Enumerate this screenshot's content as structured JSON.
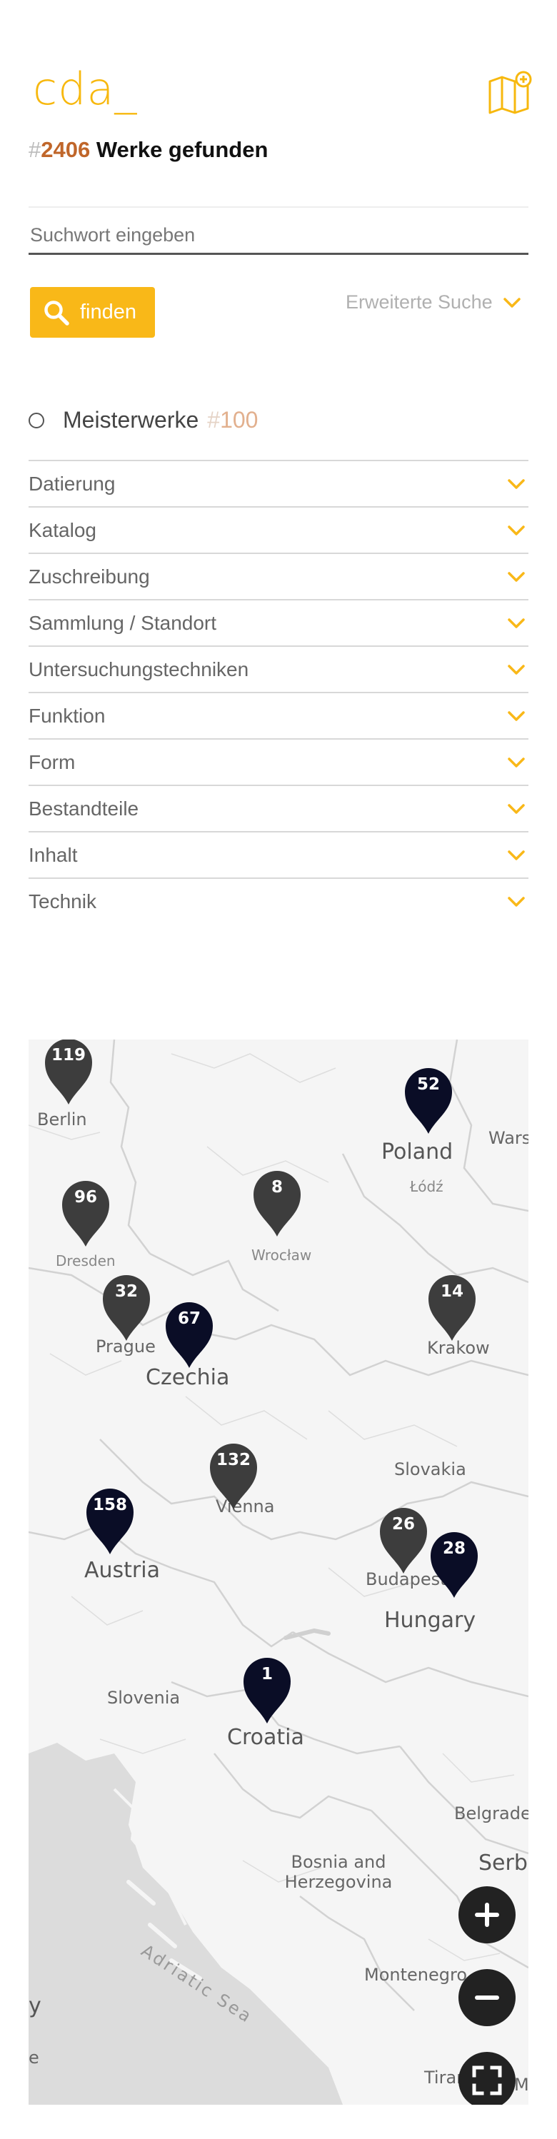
{
  "header": {
    "logo": "cda_",
    "map_icon": "map-plus-icon"
  },
  "results": {
    "hash": "#",
    "count": "2406",
    "label": " Werke gefunden"
  },
  "search": {
    "placeholder": "Suchwort eingeben",
    "button_label": "finden",
    "advanced_label": "Erweiterte Suche"
  },
  "masterworks": {
    "label": "Meisterwerke",
    "hash": "#",
    "count": "100"
  },
  "filters": [
    "Datierung",
    "Katalog",
    "Zuschreibung",
    "Sammlung / Standort",
    "Untersuchungstechniken",
    "Funktion",
    "Form",
    "Bestandteile",
    "Inhalt",
    "Technik"
  ],
  "map": {
    "pins": [
      {
        "label": "119",
        "dark": false
      },
      {
        "label": "52",
        "dark": true
      },
      {
        "label": "96",
        "dark": false
      },
      {
        "label": "8",
        "dark": false
      },
      {
        "label": "32",
        "dark": false
      },
      {
        "label": "67",
        "dark": true
      },
      {
        "label": "14",
        "dark": false
      },
      {
        "label": "132",
        "dark": false
      },
      {
        "label": "158",
        "dark": true
      },
      {
        "label": "26",
        "dark": false
      },
      {
        "label": "28",
        "dark": true
      },
      {
        "label": "1",
        "dark": true
      }
    ],
    "places": [
      "Berlin",
      "Poland",
      "Wars",
      "Łódź",
      "Dresden",
      "Wrocław",
      "Prague",
      "Czechia",
      "Krakow",
      "Slovakia",
      "Vienna",
      "Austria",
      "Budapest",
      "Hungary",
      "Slovenia",
      "Croatia",
      "Belgrade",
      "Bosnia and",
      "Herzegovina",
      "Serbia",
      "Adriatic Sea",
      "Montenegro",
      "Tirana",
      "y",
      "e",
      "M"
    ],
    "controls": {
      "zoom_in": "+",
      "zoom_out": "−"
    },
    "colors": {
      "pin_dark": "#0a0d26",
      "pin_grey": "#3d3d3d",
      "accent": "#f9b818"
    }
  }
}
